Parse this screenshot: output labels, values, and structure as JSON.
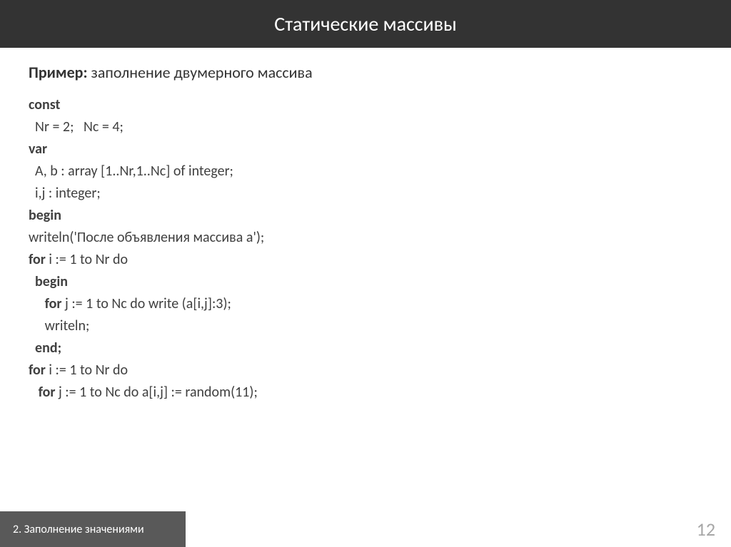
{
  "header": {
    "title": "Статические массивы"
  },
  "example": {
    "label": "Пример:",
    "description": " заполнение двумерного массива"
  },
  "code": {
    "line1_kw": "const",
    "line2": "  Nr = 2;   Nc = 4;",
    "line3_kw": "var",
    "line4": "  A, b : array [1..Nr,1..Nc] of integer;",
    "line5": "  i,j : integer;",
    "line6_kw": "begin",
    "line7": "writeln('После объявления массива a');",
    "line8_kw": "for",
    "line8_rest": " i := 1 to Nr do",
    "line9_pre": "  ",
    "line9_kw": "begin",
    "line10_pre": "     ",
    "line10_kw": "for",
    "line10_rest": " j := 1 to Nc do write (a[i,j]:3);",
    "line11": "     writeln;",
    "line12_pre": "  ",
    "line12_kw": "end;",
    "line13_kw": "for",
    "line13_rest": " i := 1 to Nr do",
    "line14_pre": "   ",
    "line14_kw": "for",
    "line14_rest": " j := 1 to Nc do a[i,j] := random(11);"
  },
  "footer": {
    "label": "2. Заполнение значениями",
    "page": "12"
  }
}
